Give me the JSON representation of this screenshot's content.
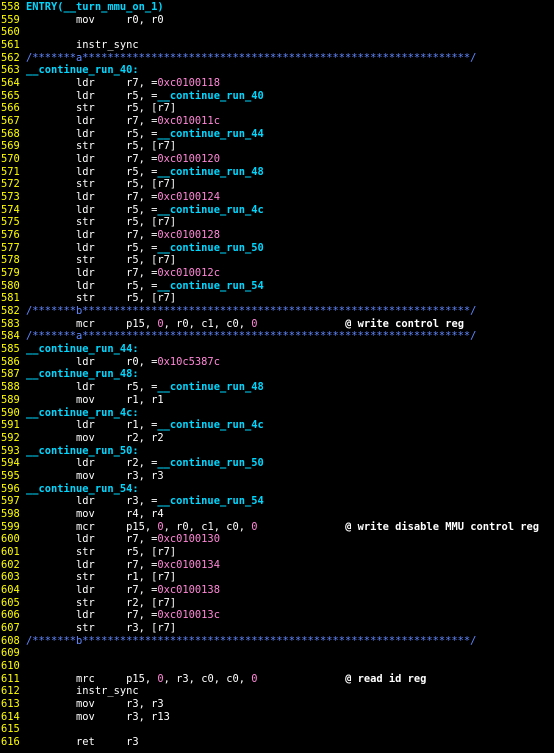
{
  "editor": {
    "colors": {
      "background": "#000000",
      "line_number": "#FFFF00",
      "label": "#00D7FF",
      "comment": "#5F87FF",
      "number": "#FF87D7",
      "text": "#FFFFFF"
    },
    "lines": [
      {
        "n": "558",
        "p": [
          {
            "t": "ENTRY(__turn_mmu_on_1)",
            "c": "lbl"
          }
        ]
      },
      {
        "n": "559",
        "p": [
          {
            "t": "        "
          },
          {
            "t": "mov",
            "c": "mn"
          },
          {
            "t": "     r0, r0",
            "c": "rg"
          }
        ]
      },
      {
        "n": "560",
        "p": []
      },
      {
        "n": "561",
        "p": [
          {
            "t": "        "
          },
          {
            "t": "instr_sync",
            "c": "mn"
          }
        ]
      },
      {
        "n": "562",
        "p": [
          {
            "t": "/*******a**************************************************************/",
            "c": "cm"
          }
        ]
      },
      {
        "n": "563",
        "p": [
          {
            "t": "__continue_run_40:",
            "c": "lbl"
          }
        ]
      },
      {
        "n": "564",
        "p": [
          {
            "t": "        "
          },
          {
            "t": "ldr",
            "c": "mn"
          },
          {
            "t": "     r7, =",
            "c": "rg"
          },
          {
            "t": "0xc0100118",
            "c": "nm"
          }
        ]
      },
      {
        "n": "565",
        "p": [
          {
            "t": "        "
          },
          {
            "t": "ldr",
            "c": "mn"
          },
          {
            "t": "     r5, =",
            "c": "rg"
          },
          {
            "t": "__continue_run_40",
            "c": "sym"
          }
        ]
      },
      {
        "n": "566",
        "p": [
          {
            "t": "        "
          },
          {
            "t": "str",
            "c": "mn"
          },
          {
            "t": "     r5, [r7]",
            "c": "rg"
          }
        ]
      },
      {
        "n": "567",
        "p": [
          {
            "t": "        "
          },
          {
            "t": "ldr",
            "c": "mn"
          },
          {
            "t": "     r7, =",
            "c": "rg"
          },
          {
            "t": "0xc010011c",
            "c": "nm"
          }
        ]
      },
      {
        "n": "568",
        "p": [
          {
            "t": "        "
          },
          {
            "t": "ldr",
            "c": "mn"
          },
          {
            "t": "     r5, =",
            "c": "rg"
          },
          {
            "t": "__continue_run_44",
            "c": "sym"
          }
        ]
      },
      {
        "n": "569",
        "p": [
          {
            "t": "        "
          },
          {
            "t": "str",
            "c": "mn"
          },
          {
            "t": "     r5, [r7]",
            "c": "rg"
          }
        ]
      },
      {
        "n": "570",
        "p": [
          {
            "t": "        "
          },
          {
            "t": "ldr",
            "c": "mn"
          },
          {
            "t": "     r7, =",
            "c": "rg"
          },
          {
            "t": "0xc0100120",
            "c": "nm"
          }
        ]
      },
      {
        "n": "571",
        "p": [
          {
            "t": "        "
          },
          {
            "t": "ldr",
            "c": "mn"
          },
          {
            "t": "     r5, =",
            "c": "rg"
          },
          {
            "t": "__continue_run_48",
            "c": "sym"
          }
        ]
      },
      {
        "n": "572",
        "p": [
          {
            "t": "        "
          },
          {
            "t": "str",
            "c": "mn"
          },
          {
            "t": "     r5, [r7]",
            "c": "rg"
          }
        ]
      },
      {
        "n": "573",
        "p": [
          {
            "t": "        "
          },
          {
            "t": "ldr",
            "c": "mn"
          },
          {
            "t": "     r7, =",
            "c": "rg"
          },
          {
            "t": "0xc0100124",
            "c": "nm"
          }
        ]
      },
      {
        "n": "574",
        "p": [
          {
            "t": "        "
          },
          {
            "t": "ldr",
            "c": "mn"
          },
          {
            "t": "     r5, =",
            "c": "rg"
          },
          {
            "t": "__continue_run_4c",
            "c": "sym"
          }
        ]
      },
      {
        "n": "575",
        "p": [
          {
            "t": "        "
          },
          {
            "t": "str",
            "c": "mn"
          },
          {
            "t": "     r5, [r7]",
            "c": "rg"
          }
        ]
      },
      {
        "n": "576",
        "p": [
          {
            "t": "        "
          },
          {
            "t": "ldr",
            "c": "mn"
          },
          {
            "t": "     r7, =",
            "c": "rg"
          },
          {
            "t": "0xc0100128",
            "c": "nm"
          }
        ]
      },
      {
        "n": "577",
        "p": [
          {
            "t": "        "
          },
          {
            "t": "ldr",
            "c": "mn"
          },
          {
            "t": "     r5, =",
            "c": "rg"
          },
          {
            "t": "__continue_run_50",
            "c": "sym"
          }
        ]
      },
      {
        "n": "578",
        "p": [
          {
            "t": "        "
          },
          {
            "t": "str",
            "c": "mn"
          },
          {
            "t": "     r5, [r7]",
            "c": "rg"
          }
        ]
      },
      {
        "n": "579",
        "p": [
          {
            "t": "        "
          },
          {
            "t": "ldr",
            "c": "mn"
          },
          {
            "t": "     r7, =",
            "c": "rg"
          },
          {
            "t": "0xc010012c",
            "c": "nm"
          }
        ]
      },
      {
        "n": "580",
        "p": [
          {
            "t": "        "
          },
          {
            "t": "ldr",
            "c": "mn"
          },
          {
            "t": "     r5, =",
            "c": "rg"
          },
          {
            "t": "__continue_run_54",
            "c": "sym"
          }
        ]
      },
      {
        "n": "581",
        "p": [
          {
            "t": "        "
          },
          {
            "t": "str",
            "c": "mn"
          },
          {
            "t": "     r5, [r7]",
            "c": "rg"
          }
        ]
      },
      {
        "n": "582",
        "p": [
          {
            "t": "/*******b**************************************************************/",
            "c": "cm"
          }
        ]
      },
      {
        "n": "583",
        "p": [
          {
            "t": "        "
          },
          {
            "t": "mcr",
            "c": "mn"
          },
          {
            "t": "     p15, ",
            "c": "rg"
          },
          {
            "t": "0",
            "c": "nm"
          },
          {
            "t": ", r0, c1, c0, ",
            "c": "rg"
          },
          {
            "t": "0",
            "c": "nm"
          },
          {
            "t": "              "
          },
          {
            "t": "@ write control reg",
            "c": "at"
          }
        ]
      },
      {
        "n": "584",
        "p": [
          {
            "t": "/*******a**************************************************************/",
            "c": "cm"
          }
        ]
      },
      {
        "n": "585",
        "p": [
          {
            "t": "__continue_run_44:",
            "c": "lbl"
          }
        ]
      },
      {
        "n": "586",
        "p": [
          {
            "t": "        "
          },
          {
            "t": "ldr",
            "c": "mn"
          },
          {
            "t": "     r0, =",
            "c": "rg"
          },
          {
            "t": "0x10c5387c",
            "c": "nm"
          }
        ]
      },
      {
        "n": "587",
        "p": [
          {
            "t": "__continue_run_48:",
            "c": "lbl"
          }
        ]
      },
      {
        "n": "588",
        "p": [
          {
            "t": "        "
          },
          {
            "t": "ldr",
            "c": "mn"
          },
          {
            "t": "     r5, =",
            "c": "rg"
          },
          {
            "t": "__continue_run_48",
            "c": "sym"
          }
        ]
      },
      {
        "n": "589",
        "p": [
          {
            "t": "        "
          },
          {
            "t": "mov",
            "c": "mn"
          },
          {
            "t": "     r1, r1",
            "c": "rg"
          }
        ]
      },
      {
        "n": "590",
        "p": [
          {
            "t": "__continue_run_4c:",
            "c": "lbl"
          }
        ]
      },
      {
        "n": "591",
        "p": [
          {
            "t": "        "
          },
          {
            "t": "ldr",
            "c": "mn"
          },
          {
            "t": "     r1, =",
            "c": "rg"
          },
          {
            "t": "__continue_run_4c",
            "c": "sym"
          }
        ]
      },
      {
        "n": "592",
        "p": [
          {
            "t": "        "
          },
          {
            "t": "mov",
            "c": "mn"
          },
          {
            "t": "     r2, r2",
            "c": "rg"
          }
        ]
      },
      {
        "n": "593",
        "p": [
          {
            "t": "__continue_run_50:",
            "c": "lbl"
          }
        ]
      },
      {
        "n": "594",
        "p": [
          {
            "t": "        "
          },
          {
            "t": "ldr",
            "c": "mn"
          },
          {
            "t": "     r2, =",
            "c": "rg"
          },
          {
            "t": "__continue_run_50",
            "c": "sym"
          }
        ]
      },
      {
        "n": "595",
        "p": [
          {
            "t": "        "
          },
          {
            "t": "mov",
            "c": "mn"
          },
          {
            "t": "     r3, r3",
            "c": "rg"
          }
        ]
      },
      {
        "n": "596",
        "p": [
          {
            "t": "__continue_run_54:",
            "c": "lbl"
          }
        ]
      },
      {
        "n": "597",
        "p": [
          {
            "t": "        "
          },
          {
            "t": "ldr",
            "c": "mn"
          },
          {
            "t": "     r3, =",
            "c": "rg"
          },
          {
            "t": "__continue_run_54",
            "c": "sym"
          }
        ]
      },
      {
        "n": "598",
        "p": [
          {
            "t": "        "
          },
          {
            "t": "mov",
            "c": "mn"
          },
          {
            "t": "     r4, r4",
            "c": "rg"
          }
        ]
      },
      {
        "n": "599",
        "p": [
          {
            "t": "        "
          },
          {
            "t": "mcr",
            "c": "mn"
          },
          {
            "t": "     p15, ",
            "c": "rg"
          },
          {
            "t": "0",
            "c": "nm"
          },
          {
            "t": ", r0, c1, c0, ",
            "c": "rg"
          },
          {
            "t": "0",
            "c": "nm"
          },
          {
            "t": "              "
          },
          {
            "t": "@ write disable MMU control reg",
            "c": "at"
          }
        ]
      },
      {
        "n": "600",
        "p": [
          {
            "t": "        "
          },
          {
            "t": "ldr",
            "c": "mn"
          },
          {
            "t": "     r7, =",
            "c": "rg"
          },
          {
            "t": "0xc0100130",
            "c": "nm"
          }
        ]
      },
      {
        "n": "601",
        "p": [
          {
            "t": "        "
          },
          {
            "t": "str",
            "c": "mn"
          },
          {
            "t": "     r5, [r7]",
            "c": "rg"
          }
        ]
      },
      {
        "n": "602",
        "p": [
          {
            "t": "        "
          },
          {
            "t": "ldr",
            "c": "mn"
          },
          {
            "t": "     r7, =",
            "c": "rg"
          },
          {
            "t": "0xc0100134",
            "c": "nm"
          }
        ]
      },
      {
        "n": "603",
        "p": [
          {
            "t": "        "
          },
          {
            "t": "str",
            "c": "mn"
          },
          {
            "t": "     r1, [r7]",
            "c": "rg"
          }
        ]
      },
      {
        "n": "604",
        "p": [
          {
            "t": "        "
          },
          {
            "t": "ldr",
            "c": "mn"
          },
          {
            "t": "     r7, =",
            "c": "rg"
          },
          {
            "t": "0xc0100138",
            "c": "nm"
          }
        ]
      },
      {
        "n": "605",
        "p": [
          {
            "t": "        "
          },
          {
            "t": "str",
            "c": "mn"
          },
          {
            "t": "     r2, [r7]",
            "c": "rg"
          }
        ]
      },
      {
        "n": "606",
        "p": [
          {
            "t": "        "
          },
          {
            "t": "ldr",
            "c": "mn"
          },
          {
            "t": "     r7, =",
            "c": "rg"
          },
          {
            "t": "0xc010013c",
            "c": "nm"
          }
        ]
      },
      {
        "n": "607",
        "p": [
          {
            "t": "        "
          },
          {
            "t": "str",
            "c": "mn"
          },
          {
            "t": "     r3, [r7]",
            "c": "rg"
          }
        ]
      },
      {
        "n": "608",
        "p": [
          {
            "t": "/*******b**************************************************************/",
            "c": "cm"
          }
        ]
      },
      {
        "n": "609",
        "p": []
      },
      {
        "n": "610",
        "p": []
      },
      {
        "n": "611",
        "p": [
          {
            "t": "        "
          },
          {
            "t": "mrc",
            "c": "mn"
          },
          {
            "t": "     p15, ",
            "c": "rg"
          },
          {
            "t": "0",
            "c": "nm"
          },
          {
            "t": ", r3, c0, c0, ",
            "c": "rg"
          },
          {
            "t": "0",
            "c": "nm"
          },
          {
            "t": "              "
          },
          {
            "t": "@ read id reg",
            "c": "at"
          }
        ]
      },
      {
        "n": "612",
        "p": [
          {
            "t": "        "
          },
          {
            "t": "instr_sync",
            "c": "mn"
          }
        ]
      },
      {
        "n": "613",
        "p": [
          {
            "t": "        "
          },
          {
            "t": "mov",
            "c": "mn"
          },
          {
            "t": "     r3, r3",
            "c": "rg"
          }
        ]
      },
      {
        "n": "614",
        "p": [
          {
            "t": "        "
          },
          {
            "t": "mov",
            "c": "mn"
          },
          {
            "t": "     r3, r13",
            "c": "rg"
          }
        ]
      },
      {
        "n": "615",
        "p": []
      },
      {
        "n": "616",
        "p": [
          {
            "t": "        "
          },
          {
            "t": "ret",
            "c": "mn"
          },
          {
            "t": "     r3",
            "c": "rg"
          }
        ]
      }
    ]
  }
}
